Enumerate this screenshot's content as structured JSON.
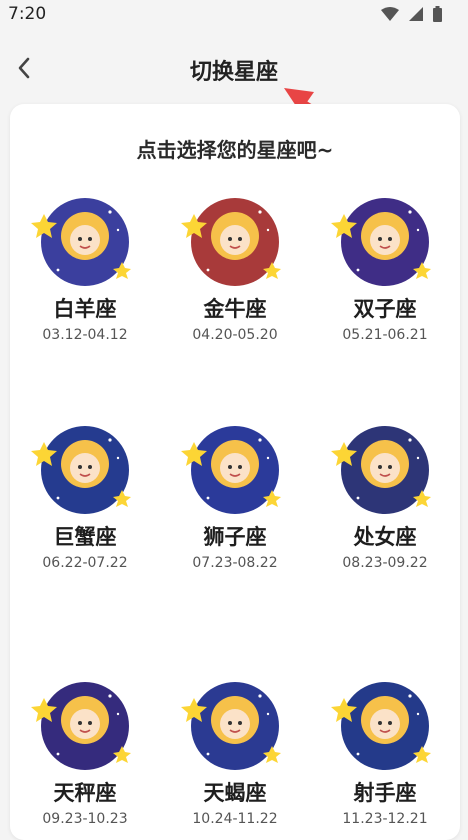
{
  "status_bar": {
    "time": "7:20"
  },
  "header": {
    "title": "切换星座"
  },
  "card": {
    "heading": "点击选择您的星座吧~"
  },
  "zodiacs": [
    {
      "name": "白羊座",
      "dates": "03.12-04.12",
      "color": "#3b3f9e"
    },
    {
      "name": "金牛座",
      "dates": "04.20-05.20",
      "color": "#a83a3a"
    },
    {
      "name": "双子座",
      "dates": "05.21-06.21",
      "color": "#3f2d86"
    },
    {
      "name": "巨蟹座",
      "dates": "06.22-07.22",
      "color": "#253b8f"
    },
    {
      "name": "狮子座",
      "dates": "07.23-08.22",
      "color": "#2b3a9a"
    },
    {
      "name": "处女座",
      "dates": "08.23-09.22",
      "color": "#2d3577"
    },
    {
      "name": "天秤座",
      "dates": "09.23-10.23",
      "color": "#352b7d"
    },
    {
      "name": "天蝎座",
      "dates": "10.24-11.22",
      "color": "#2b3a92"
    },
    {
      "name": "射手座",
      "dates": "11.23-12.21",
      "color": "#243a8a"
    }
  ]
}
